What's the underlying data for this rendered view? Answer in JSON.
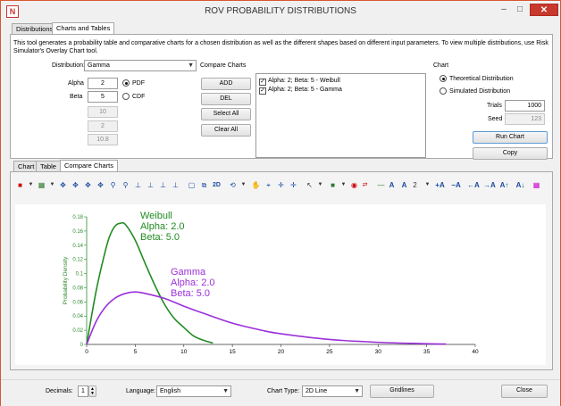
{
  "window": {
    "title": "ROV PROBABILITY DISTRIBUTIONS",
    "app_icon": "N",
    "min": "–",
    "max": "□",
    "close": "✕"
  },
  "top_tabs": [
    {
      "label": "Distributions"
    },
    {
      "label": "Charts and Tables"
    }
  ],
  "description": "This tool generates a probability table and comparative charts for a chosen distribution as well as the different shapes based on different input parameters. To view multiple distributions, use Risk Simulator's Overlay Chart tool.",
  "distribution": {
    "label": "Distribution:",
    "value": "Gamma"
  },
  "params": {
    "alpha_label": "Alpha",
    "alpha_value": "2",
    "beta_label": "Beta",
    "beta_value": "5",
    "extra1": "10",
    "extra2": "2",
    "extra3": "10.8",
    "pdf_label": "PDF",
    "cdf_label": "CDF"
  },
  "compare": {
    "label": "Compare Charts",
    "add": "ADD",
    "del": "DEL",
    "select_all": "Select All",
    "clear_all": "Clear All",
    "items": [
      {
        "label": "Alpha: 2; Beta: 5 - Weibull"
      },
      {
        "label": "Alpha: 2; Beta: 5 - Gamma"
      }
    ]
  },
  "chart_panel": {
    "label": "Chart",
    "theoretical": "Theoretical Distribution",
    "simulated": "Simulated Distribution",
    "trials_label": "Trials",
    "trials_value": "1000",
    "seed_label": "Seed",
    "seed_value": "123",
    "run_chart": "Run Chart",
    "copy": "Copy"
  },
  "bottom_tabs": [
    {
      "label": "Chart"
    },
    {
      "label": "Table"
    },
    {
      "label": "Compare Charts"
    }
  ],
  "toolbar_number": "2",
  "colors": {
    "weibull": "#228b22",
    "gamma": "#9b30d9",
    "axis": "#2e8b2e"
  },
  "chart_data": {
    "type": "line",
    "ylabel": "Probability Density",
    "xlim": [
      0,
      40
    ],
    "ylim": [
      0,
      0.18
    ],
    "xticks": [
      "0",
      "5",
      "10",
      "15",
      "20",
      "25",
      "30",
      "35",
      "40"
    ],
    "yticks": [
      "0",
      "0.02",
      "0.04",
      "0.06",
      "0.08",
      "0.1",
      "0.12",
      "0.14",
      "0.16",
      "0.18"
    ],
    "series": [
      {
        "name": "Weibull",
        "annotation": [
          "Weibull",
          "Alpha: 2.0",
          "Beta: 5.0"
        ],
        "x": [
          0,
          1,
          2,
          2.5,
          3,
          3.5,
          4,
          5,
          6,
          7,
          8,
          9,
          10,
          11,
          12,
          13
        ],
        "y": [
          0,
          0.077,
          0.136,
          0.157,
          0.168,
          0.171,
          0.169,
          0.147,
          0.115,
          0.084,
          0.057,
          0.037,
          0.024,
          0.012,
          0.006,
          0.002
        ]
      },
      {
        "name": "Gamma",
        "annotation": [
          "Gamma",
          "Alpha: 2.0",
          "Beta: 5.0"
        ],
        "x": [
          0,
          1,
          2,
          3,
          4,
          5,
          6,
          8,
          10,
          12,
          15,
          18,
          20,
          25,
          30,
          35,
          37
        ],
        "y": [
          0,
          0.033,
          0.054,
          0.066,
          0.072,
          0.074,
          0.072,
          0.065,
          0.054,
          0.044,
          0.03,
          0.02,
          0.015,
          0.007,
          0.003,
          0.001,
          0.0005
        ]
      }
    ]
  },
  "status": {
    "decimals_label": "Decimals:",
    "decimals_value": "1",
    "language_label": "Language:",
    "language_value": "English",
    "chart_type_label": "Chart Type:",
    "chart_type_value": "2D Line",
    "gridlines": "Gridlines",
    "close": "Close"
  }
}
